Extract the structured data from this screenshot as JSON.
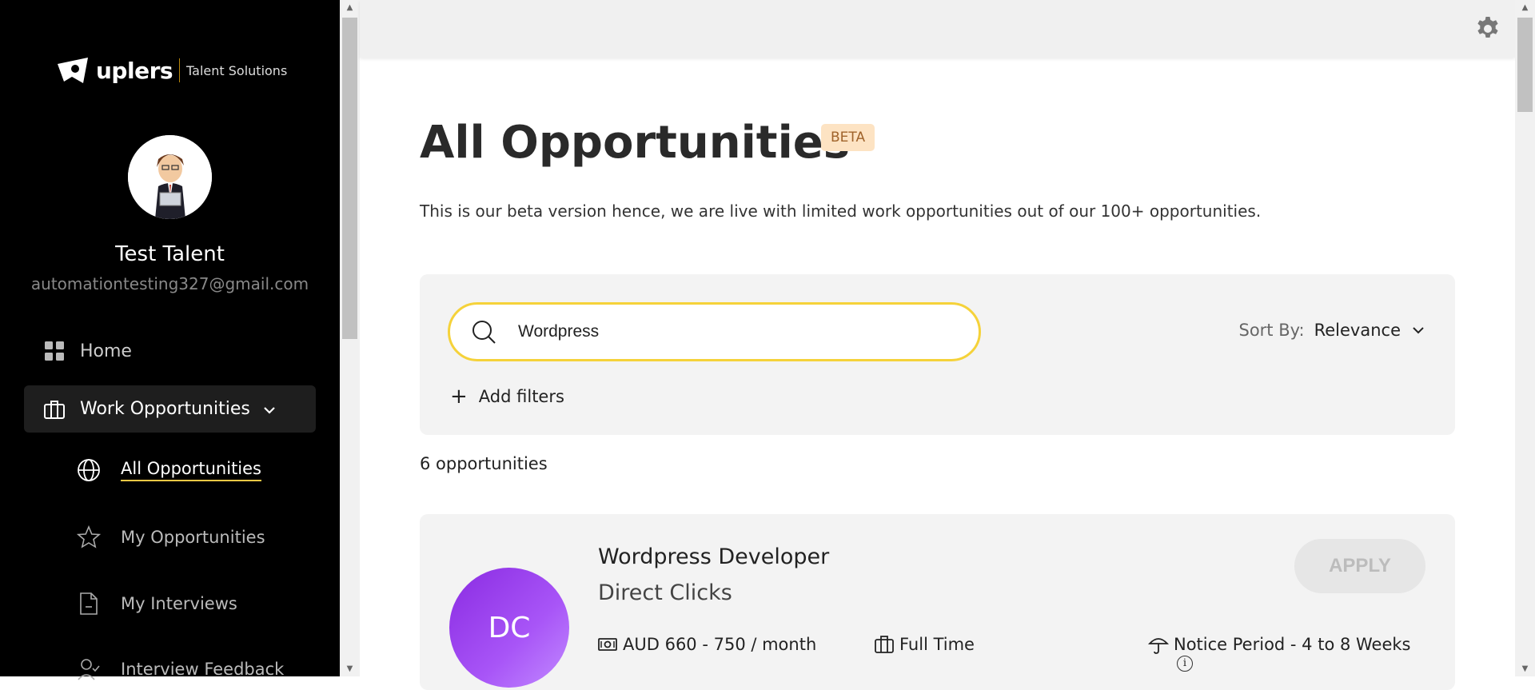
{
  "brand": {
    "name": "uplers",
    "tagline": "Talent Solutions"
  },
  "user": {
    "name": "Test Talent",
    "email": "automationtesting327@gmail.com"
  },
  "sidebar": {
    "home_label": "Home",
    "work_label": "Work Opportunities",
    "sub_items": [
      {
        "label": "All Opportunities",
        "icon": "globe-icon"
      },
      {
        "label": "My Opportunities",
        "icon": "star-icon"
      },
      {
        "label": "My Interviews",
        "icon": "document-icon"
      },
      {
        "label": "Interview Feedback",
        "icon": "user-check-icon"
      }
    ]
  },
  "main": {
    "title": "All Opportunities",
    "badge": "BETA",
    "subtitle": "This is our beta version hence, we are live with limited work opportunities out of our 100+ opportunities.",
    "search": {
      "value": "Wordpress"
    },
    "sort": {
      "label": "Sort By:",
      "value": "Relevance"
    },
    "add_filters_label": "Add filters",
    "count_label": "6 opportunities"
  },
  "jobs": [
    {
      "initials": "DC",
      "title": "Wordpress Developer",
      "company": "Direct Clicks",
      "salary": "AUD 660 - 750 / month",
      "type": "Full Time",
      "notice": "Notice Period - 4 to 8 Weeks",
      "apply_label": "APPLY"
    }
  ],
  "colors": {
    "accent": "#f5d23a",
    "sidebar_bg": "#000000",
    "card_bg": "#f3f3f3",
    "badge_bg": "#fde3c3"
  }
}
